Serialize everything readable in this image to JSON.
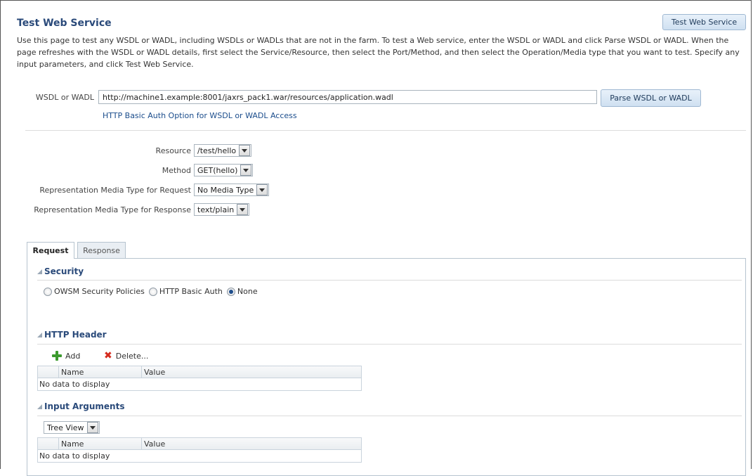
{
  "page": {
    "title": "Test Web Service",
    "test_button_label": "Test Web Service",
    "description": "Use this page to test any WSDL or WADL, including WSDLs or WADLs that are not in the farm. To test a Web service, enter the WSDL or WADL and click Parse WSDL or WADL. When the page refreshes with the WSDL or WADL details, first select the Service/Resource, then select the Port/Method, and then select the Operation/Media type that you want to test. Specify any input parameters, and click Test Web Service."
  },
  "wsdl": {
    "label": "WSDL or WADL",
    "value": "http://machine1.example:8001/jaxrs_pack1.war/resources/application.wadl",
    "parse_button_label": "Parse WSDL or WADL",
    "auth_link": "HTTP Basic Auth Option for WSDL or WADL Access"
  },
  "selectors": {
    "resource": {
      "label": "Resource",
      "value": "/test/hello"
    },
    "method": {
      "label": "Method",
      "value": "GET(hello)"
    },
    "request_media": {
      "label": "Representation Media Type for Request",
      "value": "No Media Type"
    },
    "response_media": {
      "label": "Representation Media Type for Response",
      "value": "text/plain"
    }
  },
  "tabs": [
    {
      "label": "Request",
      "active": true
    },
    {
      "label": "Response",
      "active": false
    }
  ],
  "security": {
    "title": "Security",
    "options": [
      {
        "label": "OWSM Security Policies",
        "selected": false
      },
      {
        "label": "HTTP Basic Auth",
        "selected": false
      },
      {
        "label": "None",
        "selected": true
      }
    ]
  },
  "http_header": {
    "title": "HTTP Header",
    "add_label": "Add",
    "delete_label": "Delete...",
    "columns": [
      "Name",
      "Value"
    ],
    "empty_text": "No data to display"
  },
  "input_arguments": {
    "title": "Input Arguments",
    "view_value": "Tree View",
    "columns": [
      "Name",
      "Value"
    ],
    "empty_text": "No data to display"
  },
  "colors": {
    "title": "#2a4a7a",
    "link": "#1b4d8c",
    "add_icon": "#3c9a2e",
    "delete_icon": "#d52b1e"
  }
}
